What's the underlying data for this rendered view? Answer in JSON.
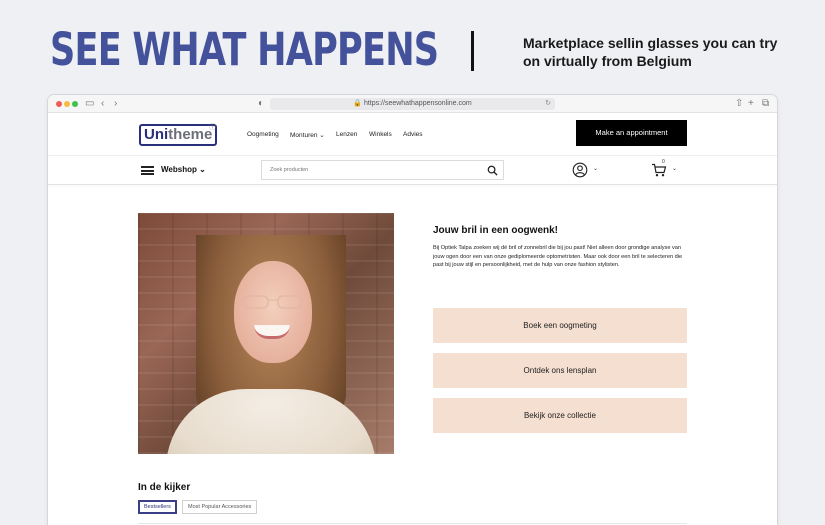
{
  "banner": {
    "title": "SEE WHAT HAPPENS",
    "tagline": "Marketplace sellin glasses you can try on virtually from Belgium"
  },
  "browser": {
    "url": "https://seewhathappensonline.com",
    "traffic_lights": [
      "#f25b54",
      "#f4bd41",
      "#3fc24a"
    ]
  },
  "site": {
    "logo_prefix": "Uni",
    "logo_suffix": "theme",
    "logo_mark": "ⓘ",
    "nav": [
      "Oogmeting",
      "Monturen ⌄",
      "Lenzen",
      "Winkels",
      "Advies"
    ],
    "appointment_button": "Make an appointment",
    "webshop_label": "Webshop ⌄",
    "search_placeholder": "Zoek producten",
    "cart_count": "0",
    "accent_color": "#2a2f7a",
    "cta_color": "#f5dfd0"
  },
  "intro": {
    "title": "Jouw bril in een oogwenk!",
    "text": "Bij Optiek Talpa zoeken wij dé bril of zonnebril die bij jou past! Niet alleen door grondige analyse van jouw ogen door een van onze gediplomeerde optometristen. Maar ook door een bril te selecteren die past bij jouw stijl en persoonlijkheid, met de hulp van onze fashion stylisten.",
    "buttons": [
      "Boek een oogmeting",
      "Ontdek ons lensplan",
      "Bekijk onze collectie"
    ]
  },
  "featured": {
    "title": "In de kijker",
    "tabs": [
      "Bestsellers",
      "Most Popular Accessories"
    ],
    "active_tab": "Bestsellers"
  }
}
